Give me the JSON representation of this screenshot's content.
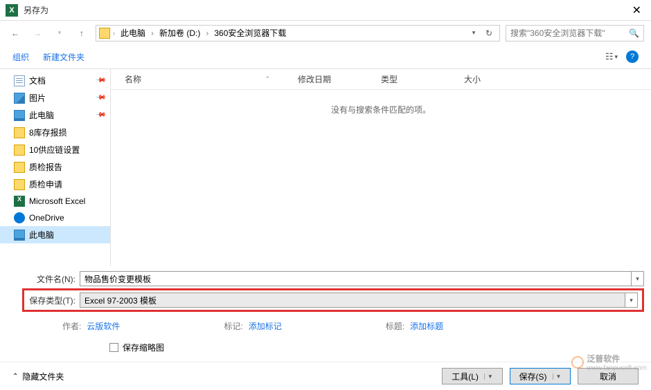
{
  "window": {
    "title": "另存为"
  },
  "breadcrumb": [
    "此电脑",
    "新加卷 (D:)",
    "360安全浏览器下载"
  ],
  "search": {
    "placeholder": "搜索\"360安全浏览器下载\""
  },
  "toolbar": {
    "organize": "组织",
    "newfolder": "新建文件夹"
  },
  "tree": [
    {
      "label": "文档",
      "ico": "ico-doc",
      "pinned": true
    },
    {
      "label": "图片",
      "ico": "ico-img",
      "pinned": true
    },
    {
      "label": "此电脑",
      "ico": "ico-pc",
      "pinned": true
    },
    {
      "label": "8库存报损",
      "ico": "ico-folder"
    },
    {
      "label": "10供应链设置",
      "ico": "ico-folder"
    },
    {
      "label": "质检报告",
      "ico": "ico-folder"
    },
    {
      "label": "质检申请",
      "ico": "ico-folder"
    },
    {
      "label": "Microsoft Excel",
      "ico": "ico-excel"
    },
    {
      "label": "OneDrive",
      "ico": "ico-onedrive"
    },
    {
      "label": "此电脑",
      "ico": "ico-pc",
      "selected": true
    }
  ],
  "columns": {
    "name": "名称",
    "date": "修改日期",
    "type": "类型",
    "size": "大小"
  },
  "empty_text": "没有与搜索条件匹配的项。",
  "fields": {
    "filename_label": "文件名(N):",
    "filename_value": "物品售价变更模板",
    "filetype_label": "保存类型(T):",
    "filetype_value": "Excel 97-2003 模板"
  },
  "meta": {
    "author_label": "作者:",
    "author_value": "云版软件",
    "tag_label": "标记:",
    "tag_value": "添加标记",
    "title_label": "标题:",
    "title_value": "添加标题"
  },
  "thumbnail_checkbox": "保存缩略图",
  "footer": {
    "hide_folders": "隐藏文件夹",
    "tools": "工具(L)",
    "save": "保存(S)",
    "cancel": "取消"
  },
  "watermark": {
    "text1": "泛普软件",
    "text2": "www.fanpusoft.com"
  }
}
